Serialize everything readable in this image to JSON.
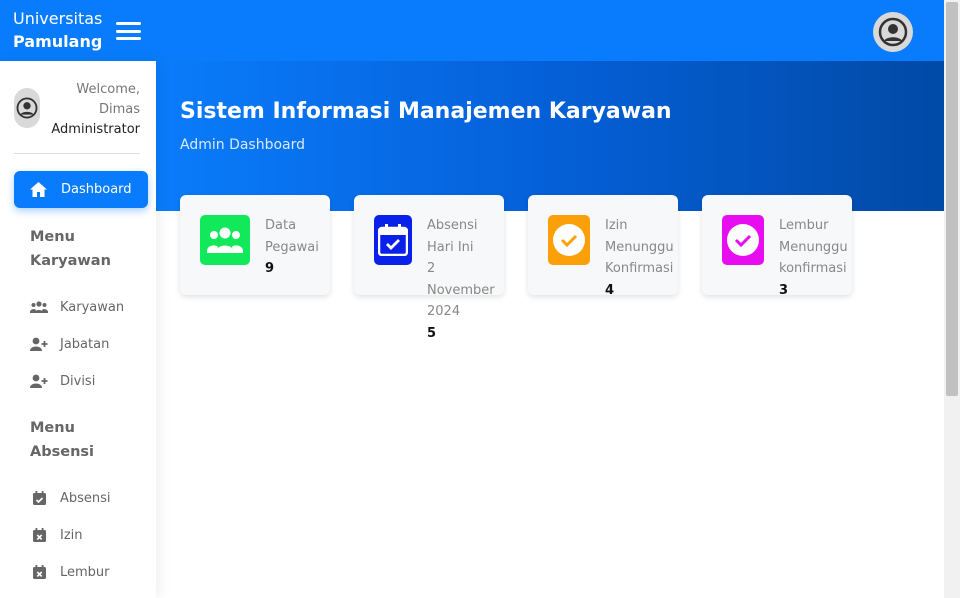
{
  "brand": {
    "line1": "Universitas",
    "line2": "Pamulang"
  },
  "user": {
    "welcome": "Welcome,",
    "name": "Dimas",
    "role": "Administrator"
  },
  "sidebar": {
    "dashboard_label": "Dashboard",
    "sections": [
      {
        "title_line1": "Menu",
        "title_line2": "Karyawan",
        "items": [
          {
            "label": "Karyawan",
            "icon": "users-icon"
          },
          {
            "label": "Jabatan",
            "icon": "user-plus-icon"
          },
          {
            "label": "Divisi",
            "icon": "user-plus-icon"
          }
        ]
      },
      {
        "title_line1": "Menu",
        "title_line2": "Absensi",
        "items": [
          {
            "label": "Absensi",
            "icon": "calendar-check-icon"
          },
          {
            "label": "Izin",
            "icon": "calendar-x-icon"
          },
          {
            "label": "Lembur",
            "icon": "calendar-x-icon"
          }
        ]
      }
    ]
  },
  "hero": {
    "title": "Sistem Informasi Manajemen Karyawan",
    "subtitle": "Admin Dashboard"
  },
  "cards": [
    {
      "lines": [
        "Data",
        "Pegawai"
      ],
      "value": "9",
      "color": "#11e85a",
      "icon": "users-icon"
    },
    {
      "lines": [
        "Absensi",
        "Hari Ini",
        "2",
        "November",
        "2024"
      ],
      "value": "5",
      "color": "#0a21ea",
      "icon": "calendar-check-icon"
    },
    {
      "lines": [
        "Izin",
        "Menunggu",
        "Konfirmasi"
      ],
      "value": "4",
      "color": "#fca00a",
      "icon": "check-circle-icon"
    },
    {
      "lines": [
        "Lembur",
        "Menunggu",
        "konfirmasi"
      ],
      "value": "3",
      "color": "#e80cf1",
      "icon": "check-circle-icon"
    }
  ],
  "colors": {
    "primary": "#087cfc",
    "hero_end": "#014aa6"
  }
}
